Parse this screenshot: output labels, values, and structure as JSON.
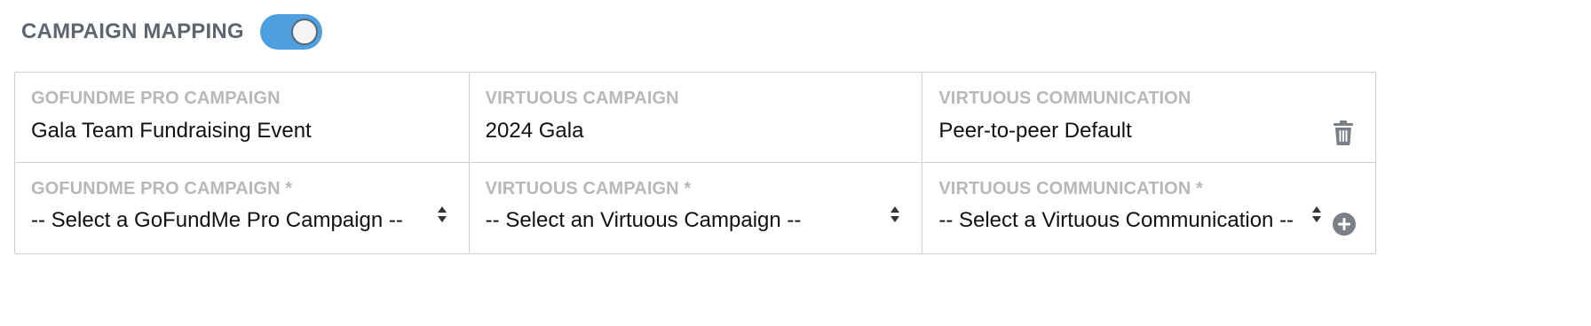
{
  "header": {
    "title": "CAMPAIGN MAPPING",
    "toggle_on": true
  },
  "mapping": {
    "existing": {
      "gofundme_label": "GOFUNDME PRO CAMPAIGN",
      "gofundme_value": "Gala Team Fundraising Event",
      "virtuous_campaign_label": "VIRTUOUS CAMPAIGN",
      "virtuous_campaign_value": "2024 Gala",
      "virtuous_comm_label": "VIRTUOUS COMMUNICATION",
      "virtuous_comm_value": "Peer-to-peer Default"
    },
    "new": {
      "gofundme_label": "GOFUNDME PRO CAMPAIGN *",
      "gofundme_selected": "-- Select a GoFundMe Pro Campaign --",
      "virtuous_campaign_label": "VIRTUOUS CAMPAIGN *",
      "virtuous_campaign_selected": "-- Select an Virtuous Campaign --",
      "virtuous_comm_label": "VIRTUOUS COMMUNICATION *",
      "virtuous_comm_selected": "-- Select a Virtuous Communication --"
    }
  },
  "icons": {
    "delete": "trash-icon",
    "add": "plus-circle-icon",
    "select": "sort-arrows-icon"
  },
  "colors": {
    "toggle": "#4d9fe0",
    "title": "#5b6671",
    "label": "#b8b8b8",
    "icon": "#7a8088",
    "border": "#cfcfcf"
  }
}
